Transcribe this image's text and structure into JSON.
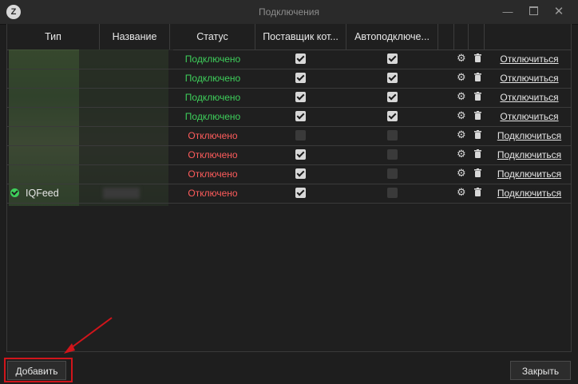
{
  "window": {
    "title": "Подключения",
    "logo": "app-logo-icon"
  },
  "grid": {
    "columns": [
      "Тип",
      "Название",
      "Статус",
      "Поставщик кот...",
      "Автоподключе..."
    ],
    "rows": [
      {
        "type": "",
        "name": "",
        "status": "Подключено",
        "state": "on",
        "provider": true,
        "auto": true,
        "action": "Отключиться"
      },
      {
        "type": "",
        "name": "",
        "status": "Подключено",
        "state": "on",
        "provider": true,
        "auto": true,
        "action": "Отключиться"
      },
      {
        "type": "",
        "name": "",
        "status": "Подключено",
        "state": "on",
        "provider": true,
        "auto": true,
        "action": "Отключиться"
      },
      {
        "type": "",
        "name": "",
        "status": "Подключено",
        "state": "on",
        "provider": true,
        "auto": true,
        "action": "Отключиться"
      },
      {
        "type": "",
        "name": "",
        "status": "Отключено",
        "state": "off",
        "provider": false,
        "auto": false,
        "action": "Подключиться"
      },
      {
        "type": "",
        "name": "",
        "status": "Отключено",
        "state": "off",
        "provider": true,
        "auto": false,
        "action": "Подключиться"
      },
      {
        "type": "",
        "name": "",
        "status": "Отключено",
        "state": "off",
        "provider": true,
        "auto": false,
        "action": "Подключиться"
      },
      {
        "type": "IQFeed",
        "name": "",
        "status": "Отключено",
        "state": "off",
        "provider": true,
        "auto": false,
        "action": "Подключиться"
      }
    ]
  },
  "footer": {
    "add_label": "Добавить",
    "close_label": "Закрыть"
  },
  "colors": {
    "connected": "#3ecf5b",
    "disconnected": "#ff5c5c",
    "highlight": "#d0151b"
  }
}
